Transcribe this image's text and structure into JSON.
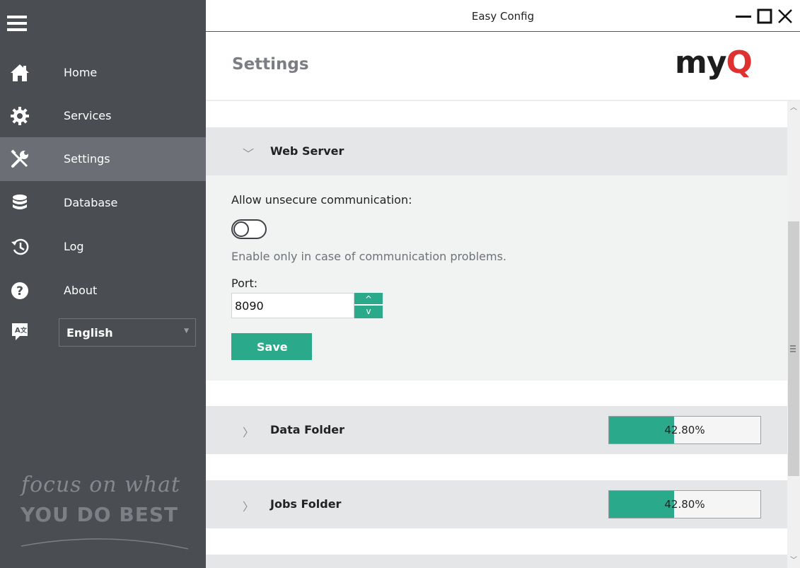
{
  "window": {
    "title": "Easy Config"
  },
  "sidebar": {
    "items": [
      {
        "label": "Home",
        "icon": "home-icon",
        "active": false
      },
      {
        "label": "Services",
        "icon": "gear-icon",
        "active": false
      },
      {
        "label": "Settings",
        "icon": "tools-icon",
        "active": true
      },
      {
        "label": "Database",
        "icon": "database-icon",
        "active": false
      },
      {
        "label": "Log",
        "icon": "history-icon",
        "active": false
      },
      {
        "label": "About",
        "icon": "help-icon",
        "active": false
      }
    ],
    "language": {
      "selected": "English",
      "icon": "translate-icon"
    },
    "slogan_line1": "focus on what",
    "slogan_line2": "YOU DO BEST"
  },
  "header": {
    "title": "Settings",
    "logo": "myQ"
  },
  "sections": {
    "web_server": {
      "title": "Web Server",
      "expanded": true,
      "allow_label": "Allow unsecure communication:",
      "toggle_on": false,
      "hint": "Enable only in case of communication problems.",
      "port_label": "Port:",
      "port_value": "8090",
      "save_label": "Save"
    },
    "data_folder": {
      "title": "Data Folder",
      "expanded": false,
      "usage_text": "42.80%",
      "usage_fraction": 0.428
    },
    "jobs_folder": {
      "title": "Jobs Folder",
      "expanded": false,
      "usage_text": "42.80%",
      "usage_fraction": 0.428
    }
  },
  "colors": {
    "sidebar_bg": "#4a4e53",
    "sidebar_active": "#6b6f75",
    "accent": "#2aaa8a",
    "brand_red": "#e03131"
  }
}
